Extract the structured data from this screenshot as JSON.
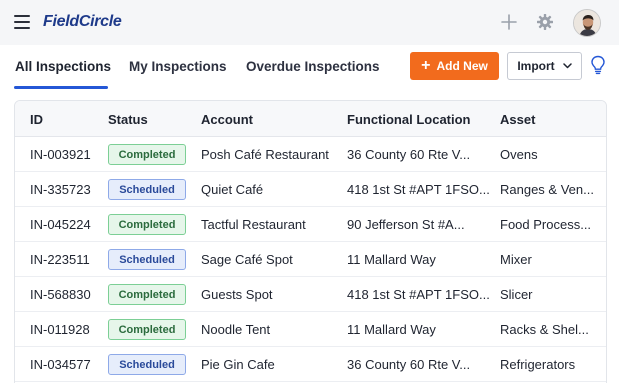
{
  "app": {
    "logo_text": "FieldCircle"
  },
  "header": {
    "icons": [
      "hamburger-menu-icon",
      "plus-icon",
      "gear-icon",
      "user-avatar"
    ]
  },
  "tabs": [
    {
      "label": "All Inspections",
      "active": true
    },
    {
      "label": "My Inspections",
      "active": false
    },
    {
      "label": "Overdue Inspections",
      "active": false
    }
  ],
  "toolbar": {
    "add_label": "Add New",
    "import_label": "Import",
    "accent_color": "#f26b1d"
  },
  "table": {
    "columns": [
      "ID",
      "Status",
      "Account",
      "Functional Location",
      "Asset"
    ],
    "rows": [
      {
        "id": "IN-003921",
        "status": "Completed",
        "account": "Posh Café Restaurant",
        "location": "36 County 60 Rte V...",
        "asset": "Ovens"
      },
      {
        "id": "IN-335723",
        "status": "Scheduled",
        "account": "Quiet Café",
        "location": "418 1st St #APT 1FSO...",
        "asset": "Ranges & Ven..."
      },
      {
        "id": "IN-045224",
        "status": "Completed",
        "account": "Tactful Restaurant",
        "location": "90 Jefferson St #A...",
        "asset": "Food Process..."
      },
      {
        "id": "IN-223511",
        "status": "Scheduled",
        "account": "Sage Café Spot",
        "location": "11 Mallard Way",
        "asset": "Mixer"
      },
      {
        "id": "IN-568830",
        "status": "Completed",
        "account": "Guests Spot",
        "location": "418 1st St #APT 1FSO...",
        "asset": "Slicer"
      },
      {
        "id": "IN-011928",
        "status": "Completed",
        "account": "Noodle Tent",
        "location": "11 Mallard Way",
        "asset": "Racks & Shel..."
      },
      {
        "id": "IN-034577",
        "status": "Scheduled",
        "account": "Pie Gin Cafe",
        "location": "36 County 60 Rte V...",
        "asset": "Refrigerators"
      }
    ]
  },
  "status_colors": {
    "Completed": "#2b6b3d",
    "Scheduled": "#2a4a9a"
  }
}
